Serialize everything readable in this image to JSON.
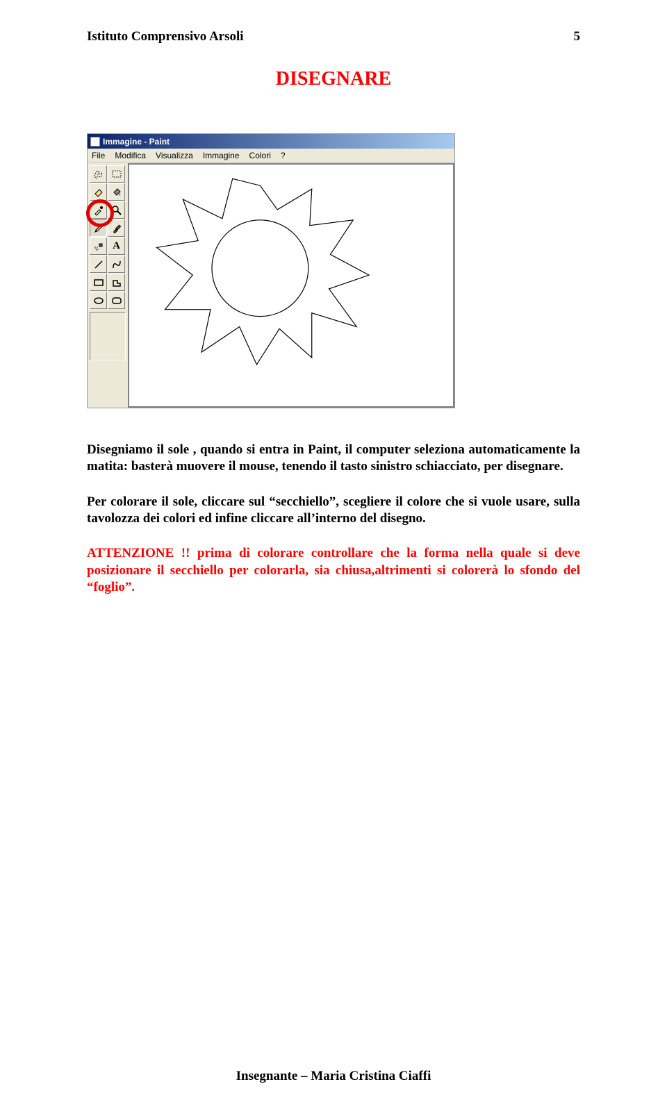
{
  "header": {
    "left": "Istituto Comprensivo Arsoli",
    "right": "5"
  },
  "title": "DISEGNARE",
  "paint": {
    "titlebar": "Immagine - Paint",
    "menu": [
      "File",
      "Modifica",
      "Visualizza",
      "Immagine",
      "Colori",
      "?"
    ]
  },
  "para1": "Disegniamo  il sole , quando si entra in Paint, il computer seleziona automaticamente la matita: basterà muovere il mouse, tenendo il tasto sinistro schiacciato, per disegnare.",
  "para2": "Per colorare il sole, cliccare sul “secchiello”, scegliere il colore che si vuole usare, sulla tavolozza dei colori ed infine cliccare all’interno del disegno.",
  "attn": {
    "label": "ATTENZIONE !!",
    "text": " prima di colorare controllare che la forma nella quale si deve posizionare il secchiello per colorarla, sia chiusa,altrimenti si colorerà lo sfondo del “foglio”."
  },
  "footer": "Insegnante – Maria Cristina Ciaffi"
}
